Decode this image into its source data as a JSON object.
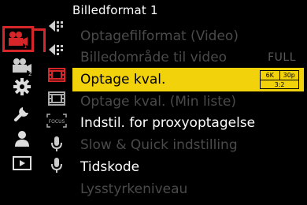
{
  "header": {
    "title": "Billedformat 1"
  },
  "menu": {
    "items": [
      {
        "label": "Optagefilformat (Video)",
        "value": "",
        "state": "disabled"
      },
      {
        "label": "Billedområde til video",
        "value": "FULL",
        "state": "disabled"
      },
      {
        "label": "Optage kval.",
        "value": "",
        "state": "selected"
      },
      {
        "label": "Optage kval. (Min liste)",
        "value": "",
        "state": "disabled"
      },
      {
        "label": "Indstil. for proxyoptagelse",
        "value": "",
        "state": "active"
      },
      {
        "label": "Slow & Quick indstilling",
        "value": "",
        "state": "disabled"
      },
      {
        "label": "Tidskode",
        "value": "",
        "state": "active"
      },
      {
        "label": "Lysstyrkeniveau",
        "value": "",
        "state": "disabled"
      }
    ],
    "badge": {
      "res": "6K",
      "fps": "30p",
      "ratio": "3:2"
    }
  },
  "tabs": {
    "main": [
      {
        "name": "video-camera-1",
        "badge": "1"
      },
      {
        "name": "video-camera-2",
        "badge": "2"
      },
      {
        "name": "gear"
      },
      {
        "name": "wrench"
      },
      {
        "name": "person"
      },
      {
        "name": "playback"
      }
    ]
  },
  "colors": {
    "accent": "#d6262a",
    "highlight": "#f2d20a"
  }
}
